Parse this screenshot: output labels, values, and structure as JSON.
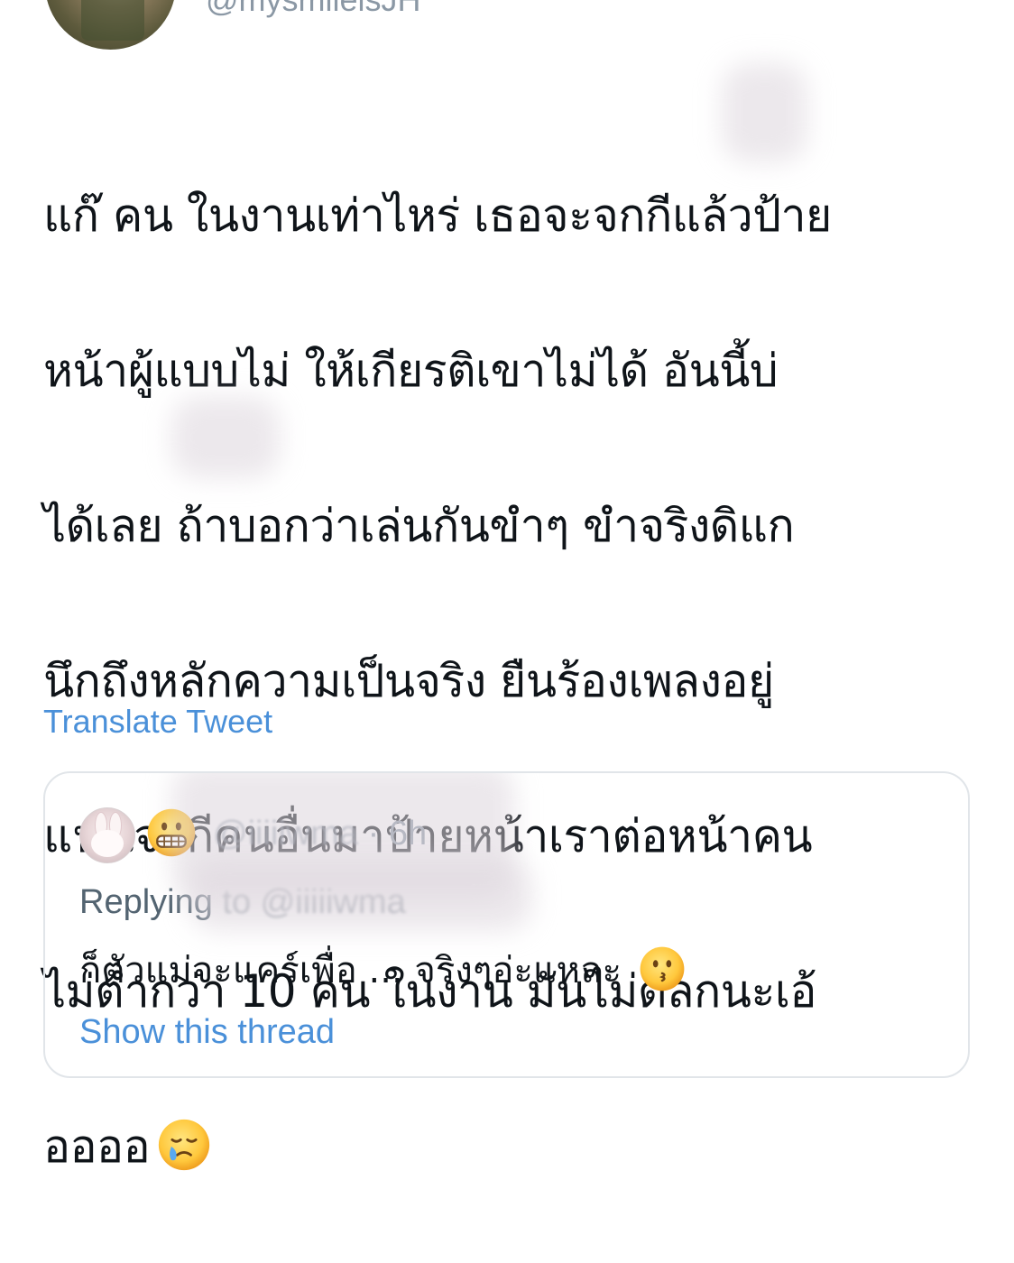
{
  "tweet": {
    "handle": "@mysmileisJH",
    "text_lines": [
      "แก๊ คน ในงานเท่าไหร่ เธอจะจกกีแล้วป้าย",
      "หน้าผู้แบบไม่ ให้เกียรติเขาไม่ได้ อันนี้บ่",
      "ได้เลย ถ้าบอกว่าเล่นกันขำๆ ขำจริงดิแก",
      "นึกถึงหลักความเป็นจริง ยืนร้องเพลงอยู่",
      "แฟนจกกีคนอื่นมาป้ายหน้าเราต่อหน้าคน",
      "ไม่ต่ำกว่า 10 คน ในงาน มันไม่ตลกนะเอ้",
      "ออออ"
    ],
    "end_emoji": "face-holding-back-tears-emoji",
    "translate_label": "Translate Tweet"
  },
  "quoted_tweet": {
    "avatar": "bunny-avatar",
    "name_emoji": "grimacing-face-emoji",
    "handle": "@iiiiiwma",
    "separator": "·",
    "time": "6h",
    "replying_prefix": "Replying",
    "replying_suffix": " to @iiiiiwma",
    "text": "ก็ตัวแม่จะแคร์เพื่อ ... จริงๆอ่ะแหละ ",
    "end_emoji": "kissing-face-emoji",
    "show_thread_label": "Show this thread"
  },
  "colors": {
    "text": "#0f1419",
    "muted": "#8b98a5",
    "link": "#4a90d9",
    "border": "#e1e5e9"
  }
}
